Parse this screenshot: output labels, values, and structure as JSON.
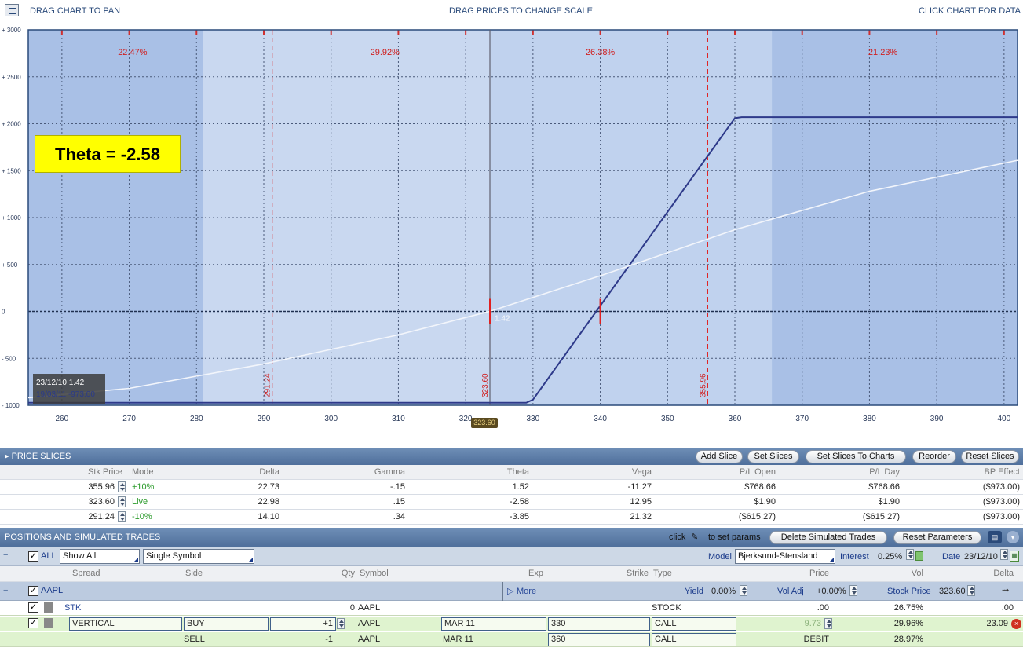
{
  "topbar": {
    "drag_pan": "DRAG CHART TO PAN",
    "drag_prices": "DRAG PRICES TO CHANGE SCALE",
    "click_chart": "CLICK CHART FOR DATA"
  },
  "annotation": {
    "theta_label": "Theta = -2.58"
  },
  "tooltip": {
    "line1": "23/12/10  1.42",
    "line2": "19/03/11  -973.00"
  },
  "current_price_marker": "323.60",
  "chart_data": {
    "type": "line",
    "xlim": [
      255,
      402
    ],
    "ylim": [
      -1000,
      3000
    ],
    "x_ticks": [
      260,
      270,
      280,
      290,
      300,
      310,
      320,
      330,
      340,
      350,
      360,
      370,
      380,
      390,
      400
    ],
    "y_ticks": [
      3000,
      2500,
      2000,
      1500,
      1000,
      500,
      0,
      -500,
      -1000
    ],
    "y_tick_labels": [
      "+ 3000",
      "+ 2500",
      "+ 2000",
      "+ 1500",
      "+ 1000",
      "+ 500",
      "0",
      "- 500",
      "- 1000"
    ],
    "zone_percents": [
      "22.47%",
      "29.92%",
      "26.38%",
      "21.23%"
    ],
    "slice_lines": [
      {
        "x": 291.24,
        "label": "291.24"
      },
      {
        "x": 323.6,
        "label": "323.60"
      },
      {
        "x": 355.96,
        "label": "355.96"
      }
    ],
    "current_price_line": 323.6,
    "current_value_label": "1.42",
    "series": [
      {
        "type": "line",
        "color": "#2e3a8a",
        "x": [
          255,
          329,
          330,
          360,
          361,
          402
        ],
        "y": [
          -973,
          -973,
          -940,
          2060,
          2070,
          2070
        ]
      },
      {
        "type": "line",
        "color": "#f2f5fb",
        "x": [
          255,
          270,
          290,
          310,
          323.6,
          340,
          360,
          380,
          402
        ],
        "y": [
          -920,
          -820,
          -560,
          -250,
          1.42,
          380,
          870,
          1280,
          1610
        ]
      }
    ]
  },
  "price_slices": {
    "title": "PRICE SLICES",
    "buttons": [
      "Add Slice",
      "Set Slices",
      "Set Slices To Charts",
      "Reorder",
      "Reset Slices"
    ],
    "headers": [
      "Stk Price",
      "Mode",
      "Delta",
      "Gamma",
      "Theta",
      "Vega",
      "P/L Open",
      "P/L Day",
      "BP Effect"
    ],
    "rows": [
      [
        "355.96",
        "+10%",
        "22.73",
        "-.15",
        "1.52",
        "-11.27",
        "$768.66",
        "$768.66",
        "($973.00)"
      ],
      [
        "323.60",
        "Live",
        "22.98",
        ".15",
        "-2.58",
        "12.95",
        "$1.90",
        "$1.90",
        "($973.00)"
      ],
      [
        "291.24",
        "-10%",
        "14.10",
        ".34",
        "-3.85",
        "21.32",
        "($615.27)",
        "($615.27)",
        "($973.00)"
      ]
    ]
  },
  "positions": {
    "title": "POSITIONS AND SIMULATED TRADES",
    "click_text": "click",
    "set_params_text": "to set params",
    "buttons": [
      "Delete Simulated Trades",
      "Reset Parameters"
    ],
    "filter": {
      "all_label": "ALL",
      "show_all": "Show All",
      "single_symbol": "Single Symbol",
      "model_label": "Model",
      "model_value": "Bjerksund-Stensland",
      "interest_label": "Interest",
      "interest_value": "0.25%",
      "date_label": "Date",
      "date_value": "23/12/10"
    },
    "headers": [
      "Spread",
      "Side",
      "Qty",
      "Symbol",
      "Exp",
      "Strike",
      "Type",
      "Price",
      "Vol",
      "Delta"
    ],
    "symbol_row": {
      "symbol": "AAPL",
      "more": "More",
      "yield_label": "Yield",
      "yield_value": "0.00%",
      "voladj_label": "Vol Adj",
      "voladj_value": "+0.00%",
      "stock_price_label": "Stock Price",
      "stock_price_value": "323.60"
    },
    "rows": [
      {
        "spread": "STK",
        "side": "",
        "qty": "0",
        "symbol": "AAPL",
        "exp": "",
        "strike": "",
        "type": "STOCK",
        "price": ".00",
        "vol": "26.75%",
        "delta": ".00"
      },
      {
        "spread": "VERTICAL",
        "side": "BUY",
        "qty": "+1",
        "symbol": "AAPL",
        "exp": "MAR 11",
        "strike": "330",
        "type": "CALL",
        "price": "9.73",
        "vol": "29.96%",
        "delta": "23.09"
      },
      {
        "spread": "",
        "side": "SELL",
        "qty": "-1",
        "symbol": "AAPL",
        "exp": "MAR 11",
        "strike": "360",
        "type": "CALL",
        "price": "DEBIT",
        "vol": "28.97%",
        "delta": ""
      }
    ]
  }
}
